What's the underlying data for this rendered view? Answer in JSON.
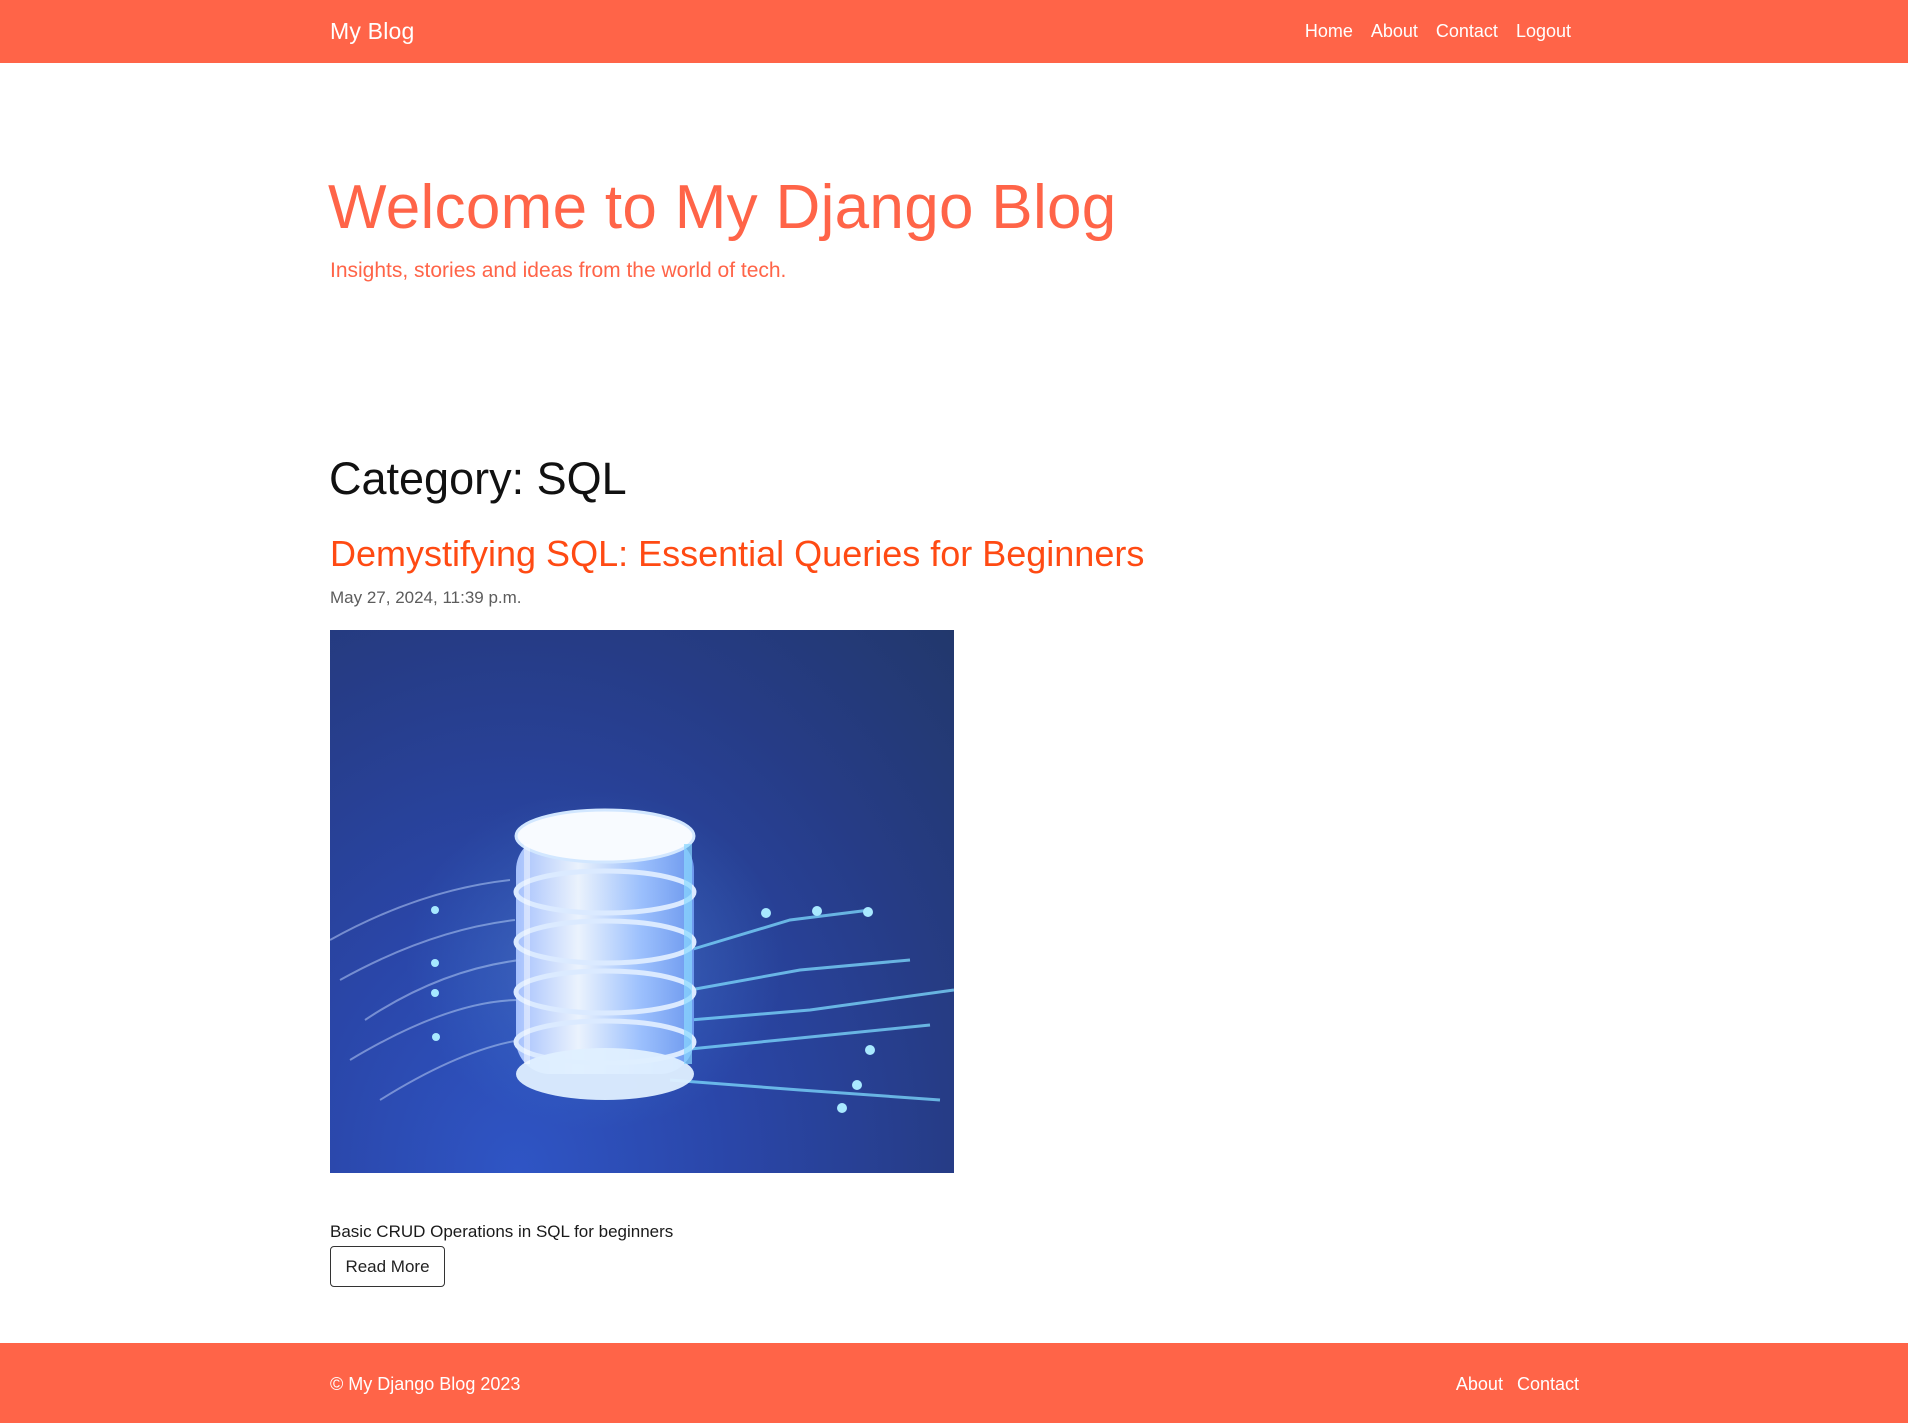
{
  "navbar": {
    "brand": "My Blog",
    "links": [
      "Home",
      "About",
      "Contact",
      "Logout"
    ]
  },
  "hero": {
    "title": "Welcome to My Django Blog",
    "subtitle": "Insights, stories and ideas from the world of tech."
  },
  "category": {
    "heading": "Category: SQL"
  },
  "post": {
    "title": "Demystifying SQL: Essential Queries for Beginners",
    "date": "May 27, 2024, 11:39 p.m.",
    "image_icon": "database-server-image",
    "excerpt": "Basic CRUD Operations in SQL for beginners",
    "read_more_label": "Read More"
  },
  "footer": {
    "copyright": "© My Django Blog 2023",
    "links": [
      "About",
      "Contact"
    ]
  },
  "colors": {
    "brand": "#ff6448",
    "post_title": "#ff4a13",
    "date_text": "#5c5c5c",
    "body_text": "#1a1a1a"
  }
}
